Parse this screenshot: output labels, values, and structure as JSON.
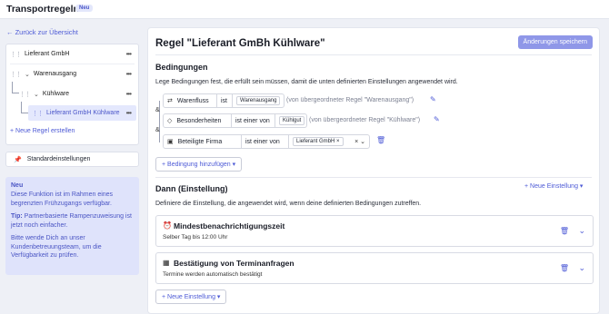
{
  "header": {
    "title": "Transportregeln",
    "badge": "Neu"
  },
  "sidebar": {
    "back_label": "Zurück zur Übersicht",
    "tree": [
      {
        "label": "Lieferant GmbH",
        "selected": false
      },
      {
        "label": "Warenausgang",
        "selected": false
      },
      {
        "label": "Kühlware",
        "selected": false
      },
      {
        "label": "Lieferant GmbH Kühlware",
        "selected": true
      }
    ],
    "new_rule_label": "+ Neue Regel erstellen",
    "standard_label": "Standardeinstellungen",
    "info": {
      "title": "Neu",
      "text": "Diese Funktion ist im Rahmen eines begrenzten Frühzugangs verfügbar.",
      "tip_bold": "Tip:",
      "tip_text": " Partnerbasierte Rampenzuweisung ist jetzt noch einfacher.",
      "contact_text": "Bitte wende Dich an unser Kundenbetreuungsteam, um die Verfügbarkeit zu prüfen."
    }
  },
  "main": {
    "title": "Regel \"Lieferant GmBh Kühlware\"",
    "save_label": "Änderungen speichern",
    "conditions": {
      "title": "Bedingungen",
      "description": "Lege Bedingungen fest, die erfüllt sein müssen, damit die unten definierten Einstellungen angewendet wird.",
      "and_label": "&",
      "rows": [
        {
          "field": "Warenfluss",
          "operator": "ist",
          "value": "Warenausgang",
          "note": "(von übergeordneter Regel \"Warenausgang\")"
        },
        {
          "field": "Besonderheiten",
          "operator": "ist einer von",
          "value": "Kühlgut",
          "note": "(von übergeordneter Regel \"Kühlware\")"
        },
        {
          "field": "Beteiligte Firma",
          "operator": "ist einer von",
          "value": "Lieferant GmbH"
        }
      ],
      "add_label": "+ Bedingung hinzufügen ▾"
    },
    "settings": {
      "title": "Dann (Einstellung)",
      "new_label": "+ Neue Einstellung ▾",
      "description": "Definiere die Einstellung, die angewendet wird, wenn deine definierten Bedingungen zutreffen.",
      "items": [
        {
          "title": "Mindestbenachrichtigungszeit",
          "subtitle": "Selber Tag bis 12:00 Uhr",
          "icon": "alarm-clock-icon"
        },
        {
          "title": "Bestätigung von Terminanfragen",
          "subtitle": "Termine werden automatisch bestätigt",
          "icon": "calendar-check-icon"
        }
      ],
      "bottom_new_label": "+ Neue Einstellung ▾"
    }
  },
  "colors": {
    "accent": "#4d5ad6",
    "save_button": "#8f97e8",
    "info_bg": "#dfe3fb",
    "selected_bg": "#e4e8fd"
  }
}
